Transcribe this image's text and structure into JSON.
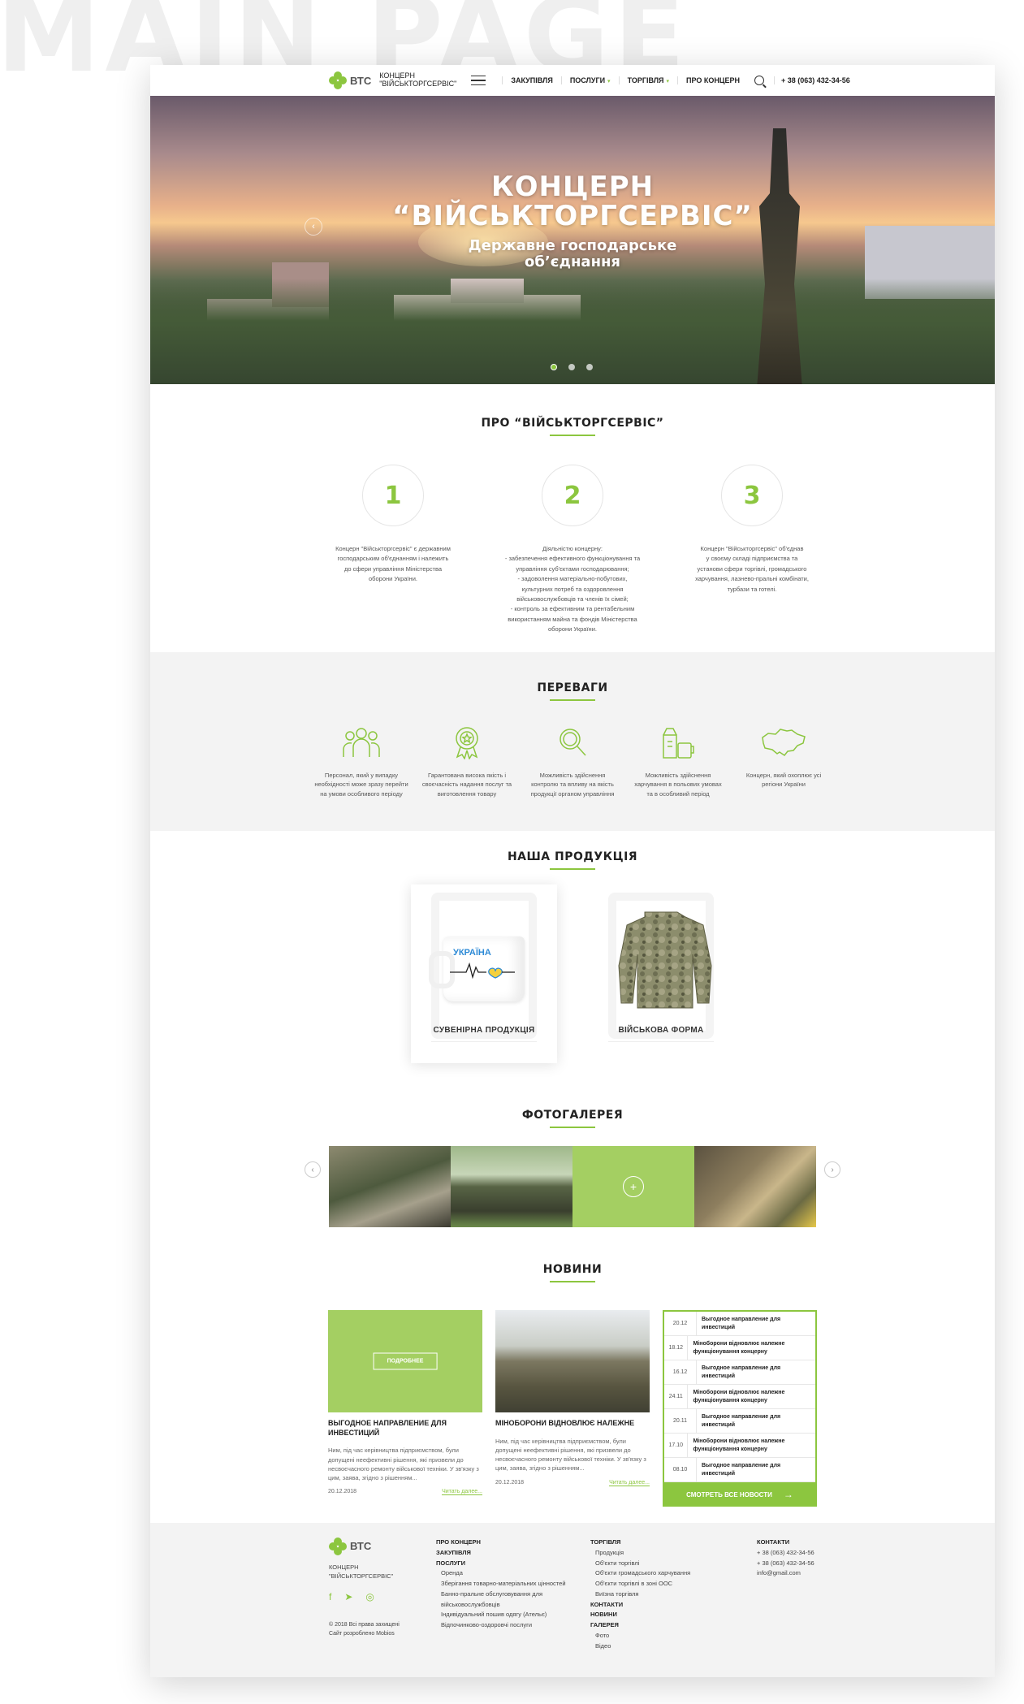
{
  "watermark": "MAIN PAGE",
  "header": {
    "logo_abbr": "ВТС",
    "logo_line1": "КОНЦЕРН",
    "logo_line2": "\"ВІЙСЬКТОРГСЕРВІС\"",
    "nav": [
      "ЗАКУПІВЛЯ",
      "ПОСЛУГИ",
      "ТОРГІВЛЯ",
      "ПРО КОНЦЕРН"
    ],
    "phone": "+ 38 (063) 432-34-56"
  },
  "hero": {
    "title_line1": "КОНЦЕРН",
    "title_line2": "“ВІЙСЬКТОРГСЕРВІС”",
    "subtitle_line1": "Державне господарське",
    "subtitle_line2": "об’єднання"
  },
  "about": {
    "title": "ПРО “ВІЙСЬКТОРГСЕРВІС”",
    "items": [
      {
        "num": "1",
        "text": "Концерн \"Військторгсервіс\" є державним\nгосподарським об'єднанням і належить\nдо сфери управління Міністерства\nоборони України."
      },
      {
        "num": "2",
        "text": "Діяльністю концерну:\n- забезпечення  ефективного функціонування та\nуправління суб'єктами господарювання;\n- задоволення матеріально-побутових,\nкультурних потреб та оздоровлення\nвійськовослужбовців та членів їх сімей;\n- контроль за ефективним та рентабельним\nвикористанням майна та фондів Міністерства\nоборони України."
      },
      {
        "num": "3",
        "text": "Концерн \"Військторгсервіс\" об'єднав\nу своєму складі підприємства та\nустанови сфери торгівлі, громадського\nхарчування, лазнево-пральні комбінати,\nтурбази та готелі."
      }
    ]
  },
  "advantages": {
    "title": "ПЕРЕВАГИ",
    "items": [
      {
        "icon": "people-icon",
        "text": "Персонал, який у випадку необхідності може зразу перейти на умови особливого періоду"
      },
      {
        "icon": "badge-icon",
        "text": "Гарантована висока якість і своєчасність надання послуг та виготовлення товару"
      },
      {
        "icon": "magnifier-icon",
        "text": "Можливість здійснення контролю та впливу на якість продукції органом управління"
      },
      {
        "icon": "food-icon",
        "text": "Можливість здійснення харчування в польових умовах та в особливий період"
      },
      {
        "icon": "ukraine-map-icon",
        "text": "Концерн, який охоплює усі регіони України"
      }
    ]
  },
  "products": {
    "title": "НАША ПРОДУКЦІЯ",
    "items": [
      {
        "label": "СУВЕНІРНА ПРОДУКЦІЯ",
        "mug_text": "УКРАЇНА"
      },
      {
        "label": "ВІЙСЬКОВА ФОРМА"
      }
    ]
  },
  "gallery": {
    "title": "ФОТОГАЛЕРЕЯ"
  },
  "news": {
    "title": "НОВИНИ",
    "more_label": "ПОДРОБНЕЕ",
    "cards": [
      {
        "title": "ВЫГОДНОЕ НАПРАВЛЕНИЕ ДЛЯ ИНВЕСТИЦИЙ",
        "text": "Ним, під час керівництва підприємством, були допущені неефективні рішення, які призвели до несвоєчасного ремонту військової техніки. У зв'язку з цим, заява, згідно з рішенням...",
        "date": "20.12.2018",
        "read": "Читать далее..."
      },
      {
        "title": "МІНОБОРОНИ ВІДНОВЛЮЄ НАЛЕЖНЕ",
        "text": "Ним, під час керівництва підприємством, були допущені неефективні рішення, які призвели до несвоєчасного ремонту військової техніки. У зв'язку з цим, заява, згідно з рішенням...",
        "date": "20.12.2018",
        "read": "Читать далее..."
      }
    ],
    "list": [
      {
        "date": "20.12",
        "title": "Выгодное направление для инвестиций"
      },
      {
        "date": "18.12",
        "title": "Міноборони відновлює належне функціонування концерну"
      },
      {
        "date": "16.12",
        "title": "Выгодное направление для инвестиций"
      },
      {
        "date": "24.11",
        "title": "Міноборони відновлює належне функціонування концерну"
      },
      {
        "date": "20.11",
        "title": "Выгодное направление для инвестиций"
      },
      {
        "date": "17.10",
        "title": "Міноборони відновлює належне функціонування концерну"
      },
      {
        "date": "08.10",
        "title": "Выгодное направление для инвестиций"
      }
    ],
    "all_label": "СМОТРЕТЬ ВСЕ НОВОСТИ"
  },
  "footer": {
    "logo_abbr": "ВТС",
    "name_line1": "КОНЦЕРН",
    "name_line2": "\"ВІЙСЬКТОРГСЕРВІС\"",
    "copyright": "© 2018 Всі права захищені",
    "dev": "Сайт розроблено Mobios",
    "col1": {
      "about": "ПРО КОНЦЕРН",
      "purchases": "ЗАКУПІВЛЯ",
      "services": "ПОСЛУГИ",
      "services_items": [
        "Оренда",
        "Зберігання товарно-матеріальних цінностей",
        "Банно-пральне обслуговування для військовослужбовців",
        "Індивідуальний пошив одягу (Ательє)",
        "Відпочинково-оздоровчі послуги"
      ]
    },
    "col2": {
      "trade": "ТОРГІВЛЯ",
      "trade_items": [
        "Продукція",
        "Об'єкти торгівлі",
        "Об'єкти громадського харчування",
        "Об'єкти торгівлі в зоні ООС",
        "Виїзна торгівля"
      ],
      "contacts": "КОНТАКТИ",
      "news": "НОВИНИ",
      "gallery": "ГАЛЕРЕЯ",
      "gallery_items": [
        "Фото",
        "Відео"
      ]
    },
    "col3": {
      "contacts": "КОНТАКТИ",
      "phone1": "+ 38 (063) 432-34-56",
      "phone2": "+ 38 (063) 432-34-56",
      "email": "info@gmail.com"
    }
  },
  "colors": {
    "accent": "#8cc63f"
  }
}
